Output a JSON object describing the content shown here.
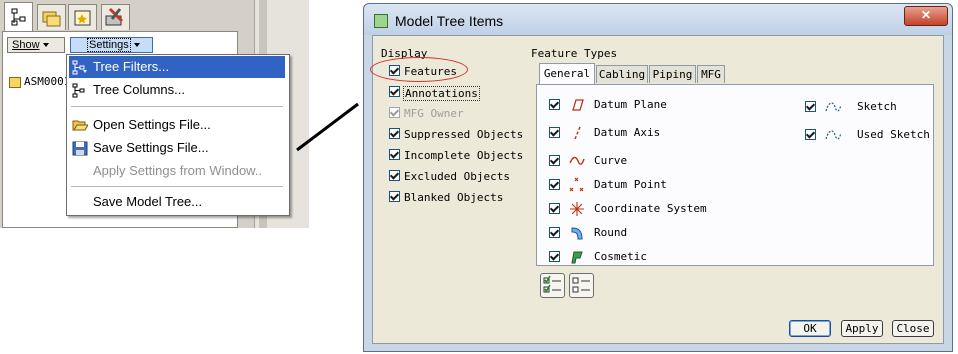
{
  "left_panel": {
    "show_button": "Show",
    "settings_button": "Settings",
    "tree_root": "ASM0001"
  },
  "settings_menu": {
    "items": [
      {
        "label": "Tree Filters...",
        "icon": "tree-filter-icon",
        "highlighted": true,
        "enabled": true
      },
      {
        "label": "Tree Columns...",
        "icon": "tree-columns-icon",
        "highlighted": false,
        "enabled": true
      },
      {
        "label": "Open Settings File...",
        "icon": "folder-open-icon",
        "highlighted": false,
        "enabled": true
      },
      {
        "label": "Save Settings File...",
        "icon": "floppy-disk-icon",
        "highlighted": false,
        "enabled": true
      },
      {
        "label": "Apply Settings from Window..",
        "icon": "",
        "highlighted": false,
        "enabled": false
      },
      {
        "label": "Save Model Tree...",
        "icon": "",
        "highlighted": false,
        "enabled": true
      }
    ]
  },
  "dialog": {
    "title": "Model Tree Items",
    "close_glyph": "✕",
    "display": {
      "label": "Display",
      "items": [
        {
          "label": "Features",
          "checked": true,
          "enabled": true
        },
        {
          "label": "Annotations",
          "checked": true,
          "enabled": true
        },
        {
          "label": "MFG Owner",
          "checked": true,
          "enabled": false
        },
        {
          "label": "Suppressed Objects",
          "checked": true,
          "enabled": true
        },
        {
          "label": "Incomplete Objects",
          "checked": true,
          "enabled": true
        },
        {
          "label": "Excluded Objects",
          "checked": true,
          "enabled": true
        },
        {
          "label": "Blanked Objects",
          "checked": true,
          "enabled": true
        }
      ]
    },
    "feature_types": {
      "label": "Feature Types",
      "tabs": [
        "General",
        "Cabling",
        "Piping",
        "MFG"
      ],
      "active_tab": "General",
      "col1": [
        {
          "label": "Datum Plane",
          "icon": "datum-plane-icon",
          "checked": true
        },
        {
          "label": "Datum Axis",
          "icon": "datum-axis-icon",
          "checked": true
        },
        {
          "label": "Curve",
          "icon": "curve-icon",
          "checked": true
        },
        {
          "label": "Datum Point",
          "icon": "datum-point-icon",
          "checked": true
        },
        {
          "label": "Coordinate System",
          "icon": "coordinate-system-icon",
          "checked": true
        },
        {
          "label": "Round",
          "icon": "round-icon",
          "checked": true
        },
        {
          "label": "Cosmetic",
          "icon": "cosmetic-icon",
          "checked": true
        }
      ],
      "col2": [
        {
          "label": "Sketch",
          "icon": "sketch-icon",
          "checked": true
        },
        {
          "label": "Used Sketch",
          "icon": "used-sketch-icon",
          "checked": true
        }
      ]
    },
    "buttons": {
      "ok": "OK",
      "apply": "Apply",
      "close": "Close"
    }
  }
}
